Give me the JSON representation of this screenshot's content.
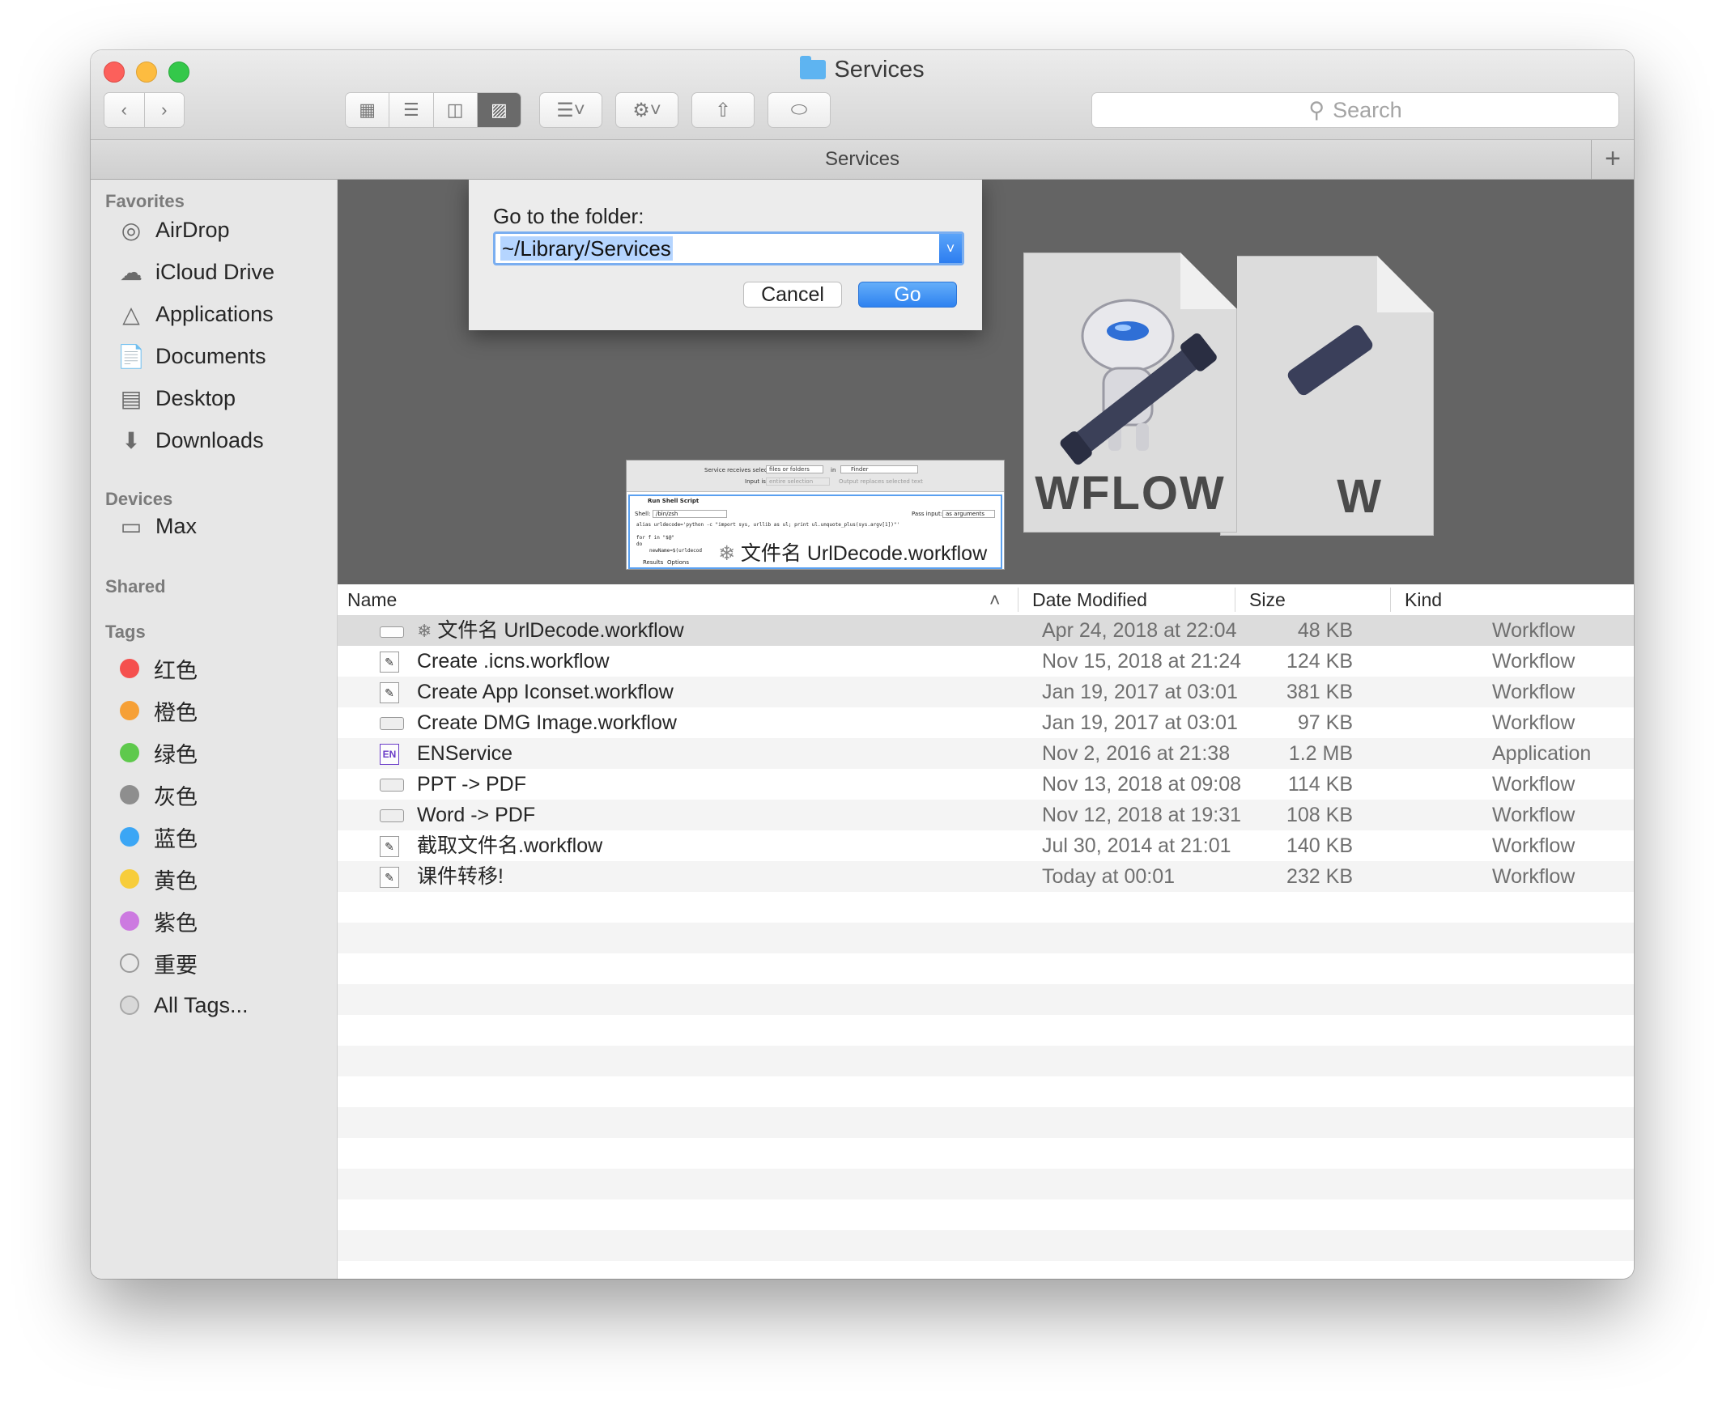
{
  "window": {
    "title": "Services"
  },
  "toolbar": {
    "back_icon": "chevron-left-icon",
    "forward_icon": "chevron-right-icon",
    "view_icons": [
      "icon-view-icon",
      "list-view-icon",
      "column-view-icon",
      "cover-flow-icon"
    ],
    "arrange_icon": "arrange-icon",
    "action_icon": "gear-icon",
    "share_icon": "share-icon",
    "tag_icon": "tag-icon",
    "search_placeholder": "Search"
  },
  "pathbar": {
    "title": "Services"
  },
  "sidebar": {
    "favorites_header": "Favorites",
    "favorites": [
      {
        "label": "AirDrop",
        "icon": "airdrop-icon"
      },
      {
        "label": "iCloud Drive",
        "icon": "cloud-icon"
      },
      {
        "label": "Applications",
        "icon": "applications-icon"
      },
      {
        "label": "Documents",
        "icon": "documents-icon"
      },
      {
        "label": "Desktop",
        "icon": "desktop-icon"
      },
      {
        "label": "Downloads",
        "icon": "downloads-icon"
      }
    ],
    "devices_header": "Devices",
    "devices": [
      {
        "label": "Max",
        "icon": "laptop-icon"
      }
    ],
    "shared_header": "Shared",
    "tags_header": "Tags",
    "tags": [
      {
        "label": "红色",
        "color": "#f5504e"
      },
      {
        "label": "橙色",
        "color": "#f6a036"
      },
      {
        "label": "绿色",
        "color": "#5ec94c"
      },
      {
        "label": "灰色",
        "color": "#8e8e8e"
      },
      {
        "label": "蓝色",
        "color": "#3ba6f5"
      },
      {
        "label": "黄色",
        "color": "#f7cd3b"
      },
      {
        "label": "紫色",
        "color": "#cc7ae0"
      },
      {
        "label": "重要",
        "color": "#e8e8e8"
      },
      {
        "label": "All Tags...",
        "color": "#d8d8d8"
      }
    ]
  },
  "dialog": {
    "label": "Go to the folder:",
    "value": "~/Library/Services",
    "cancel_label": "Cancel",
    "go_label": "Go",
    "accent": "#2e82f0"
  },
  "preview": {
    "doc_label": "WFLOW",
    "doc_label_2": "W",
    "caption": "文件名 UrlDecode.workflow",
    "thumb": {
      "receives": "Service receives selected",
      "receives_value": "files or folders",
      "in_label": "in",
      "in_value": "Finder",
      "input_is": "Input is",
      "input_value": "entire selection",
      "output": "Output replaces selected text",
      "action": "Run Shell Script",
      "shell_label": "Shell:",
      "shell_value": "/bin/zsh",
      "pass_label": "Pass input:",
      "pass_value": "as arguments",
      "code1": "alias urldecode='python -c \"import sys, urllib as ul; print ul.unquote_plus(sys.argv[1])\"'",
      "code2": "for f in \"$@\"",
      "code3": "do",
      "code4": "newName=$(urldecod",
      "tab1": "Results",
      "tab2": "Options"
    }
  },
  "list": {
    "headers": {
      "name": "Name",
      "date": "Date Modified",
      "size": "Size",
      "kind": "Kind"
    },
    "rows": [
      {
        "name": "文件名 UrlDecode.workflow",
        "date": "Apr 24, 2018 at 22:04",
        "size": "48 KB",
        "kind": "Workflow",
        "icon": "workflow-file-icon"
      },
      {
        "name": "Create .icns.workflow",
        "date": "Nov 15, 2018 at 21:24",
        "size": "124 KB",
        "kind": "Workflow",
        "icon": "workflow-file-icon"
      },
      {
        "name": "Create App Iconset.workflow",
        "date": "Jan 19, 2017 at 03:01",
        "size": "381 KB",
        "kind": "Workflow",
        "icon": "workflow-file-icon"
      },
      {
        "name": "Create DMG Image.workflow",
        "date": "Jan 19, 2017 at 03:01",
        "size": "97 KB",
        "kind": "Workflow",
        "icon": "workflow-file-icon"
      },
      {
        "name": "ENService",
        "date": "Nov 2, 2016 at 21:38",
        "size": "1.2 MB",
        "kind": "Application",
        "icon": "app-icon"
      },
      {
        "name": "PPT -> PDF",
        "date": "Nov 13, 2018 at 09:08",
        "size": "114 KB",
        "kind": "Workflow",
        "icon": "workflow-file-icon"
      },
      {
        "name": "Word -> PDF",
        "date": "Nov 12, 2018 at 19:31",
        "size": "108 KB",
        "kind": "Workflow",
        "icon": "workflow-file-icon"
      },
      {
        "name": "截取文件名.workflow",
        "date": "Jul 30, 2014 at 21:01",
        "size": "140 KB",
        "kind": "Workflow",
        "icon": "workflow-file-icon"
      },
      {
        "name": "课件转移!",
        "date": "Today at 00:01",
        "size": "232 KB",
        "kind": "Workflow",
        "icon": "workflow-file-icon"
      }
    ]
  }
}
